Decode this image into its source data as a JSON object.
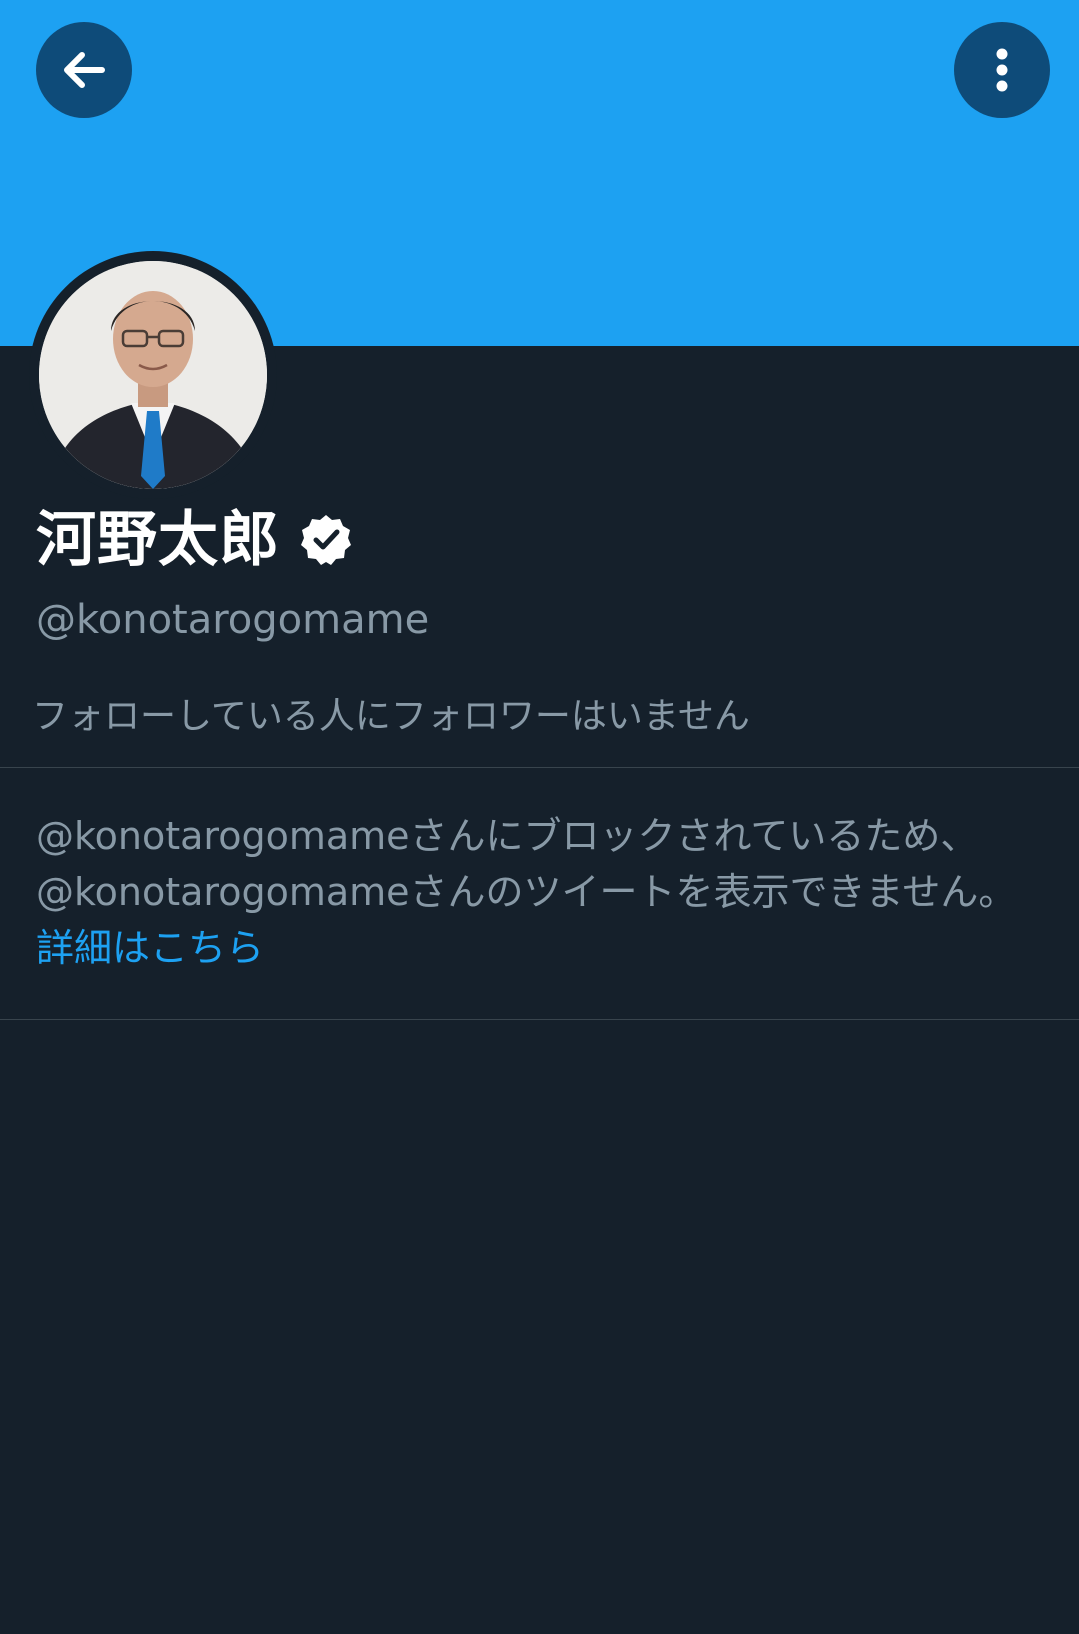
{
  "colors": {
    "banner": "#1da1f2",
    "background": "#15202b",
    "button": "#0e4b79",
    "link": "#1da1f2",
    "secondary_text": "#8899a6",
    "divider": "#38444d"
  },
  "header": {
    "back_icon": "arrow-left-icon",
    "more_icon": "more-vertical-icon"
  },
  "profile": {
    "display_name": "河野太郎",
    "verified": true,
    "verified_icon": "verified-badge-icon",
    "handle": "@konotarogomame",
    "followers_note": "フォローしている人にフォロワーはいません"
  },
  "blocked": {
    "message": "@konotarogomameさんにブロックされているため、@konotarogomameさんのツイートを表示できません。",
    "link_label": "詳細はこちら"
  }
}
